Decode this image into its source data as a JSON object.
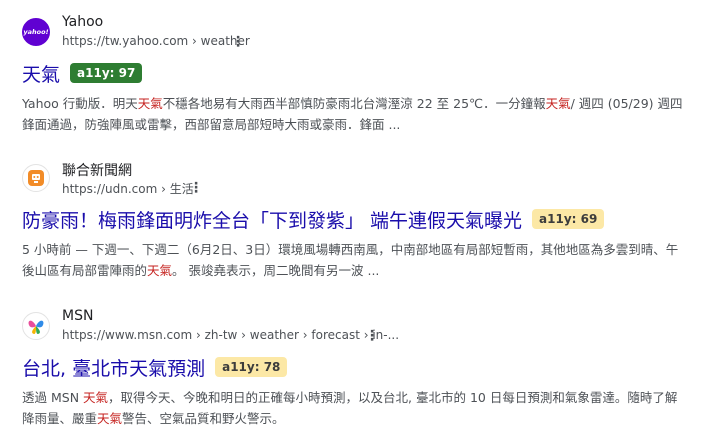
{
  "results": [
    {
      "site_name": "Yahoo",
      "url": "https://tw.yahoo.com › weather",
      "title": "天氣",
      "badge": "a11y: 97",
      "badge_color": "#2e7d32",
      "favicon_text": "yahoo!",
      "favicon_color": "#6001d2",
      "snippet": {
        "p1": "Yahoo 行動版．明天",
        "h1": "天氣",
        "p2": "不穩各地易有大雨西半部慎防豪雨北台灣溼涼 22 至 25℃．一分鐘報",
        "h2": "天氣",
        "p3": "/ 週四 (05/29) 週四鋒面通過，防強陣風或雷擊，西部留意局部短時大雨或豪雨．鋒面 ..."
      }
    },
    {
      "site_name": "聯合新聞網",
      "url": "https://udn.com › 生活",
      "title": "防豪雨！梅雨鋒面明炸全台「下到發紫」 端午連假天氣曝光",
      "badge": "a11y: 69",
      "badge_color": "#fce8a6",
      "favicon_color": "#f28c28",
      "snippet": {
        "p1": "5 小時前 — 下週一、下週二（6月2日、3日）環境風場轉西南風，中南部地區有局部短暫雨，其他地區為多雲到晴、午後山區有局部雷陣雨的",
        "h1": "天氣",
        "p2": "。 張竣堯表示，周二晚間有另一波 ..."
      }
    },
    {
      "site_name": "MSN",
      "url": "https://www.msn.com › zh-tw › weather › forecast › in-...",
      "title": "台北, 臺北市天氣預測",
      "badge": "a11y: 78",
      "badge_color": "#fce8a6",
      "snippet": {
        "p1": "透過 MSN ",
        "h1": "天氣",
        "p2": "，取得今天、今晚和明日的正確每小時預測，以及台北, 臺北市的 10 日每日預測和氣象雷達。隨時了解降雨量、嚴重",
        "h2": "天氣",
        "p3": "警告、空氣品質和野火警示。"
      }
    }
  ]
}
